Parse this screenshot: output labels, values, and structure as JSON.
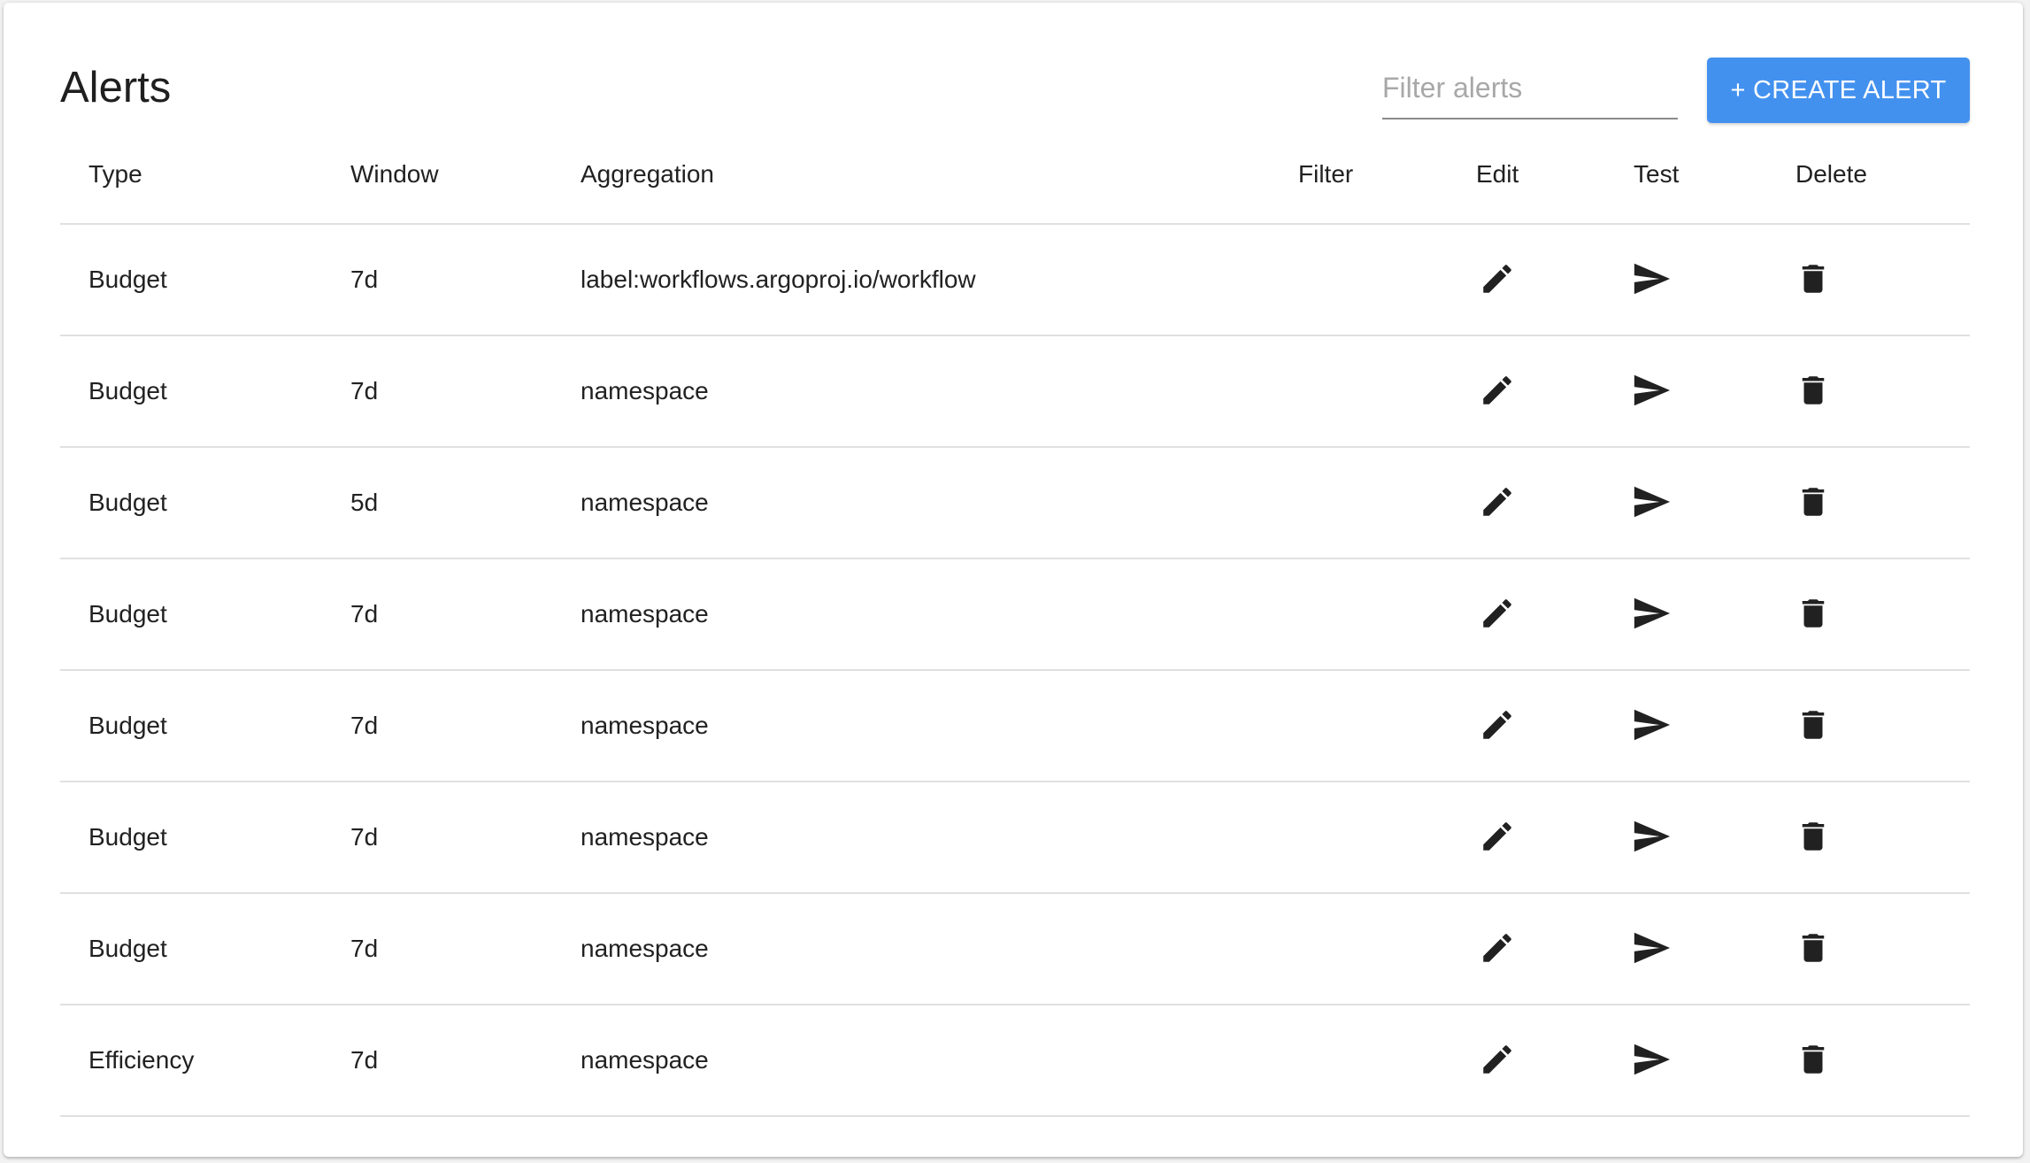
{
  "page": {
    "title": "Alerts",
    "filter_placeholder": "Filter alerts",
    "filter_value": "",
    "create_button_label": "+ CREATE ALERT",
    "accent_color": "#4391ef"
  },
  "table": {
    "headers": {
      "type": "Type",
      "window": "Window",
      "aggregation": "Aggregation",
      "filter": "Filter",
      "edit": "Edit",
      "test": "Test",
      "delete": "Delete"
    },
    "rows": [
      {
        "type": "Budget",
        "window": "7d",
        "aggregation": "label:workflows.argoproj.io/workflow",
        "filter": ""
      },
      {
        "type": "Budget",
        "window": "7d",
        "aggregation": "namespace",
        "filter": ""
      },
      {
        "type": "Budget",
        "window": "5d",
        "aggregation": "namespace",
        "filter": ""
      },
      {
        "type": "Budget",
        "window": "7d",
        "aggregation": "namespace",
        "filter": ""
      },
      {
        "type": "Budget",
        "window": "7d",
        "aggregation": "namespace",
        "filter": ""
      },
      {
        "type": "Budget",
        "window": "7d",
        "aggregation": "namespace",
        "filter": ""
      },
      {
        "type": "Budget",
        "window": "7d",
        "aggregation": "namespace",
        "filter": ""
      },
      {
        "type": "Efficiency",
        "window": "7d",
        "aggregation": "namespace",
        "filter": ""
      }
    ],
    "row_icons": {
      "edit": "pencil-icon",
      "test": "send-icon",
      "delete": "trash-icon"
    }
  }
}
